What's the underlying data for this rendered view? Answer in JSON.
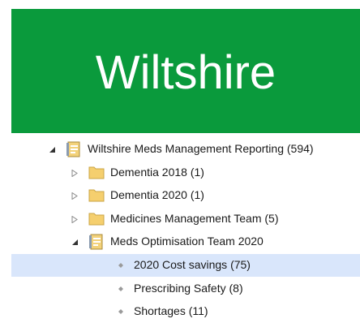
{
  "banner": {
    "title": "Wiltshire"
  },
  "tree": {
    "root": {
      "label": "Wiltshire Meds Management Reporting (594)",
      "expanded": true,
      "icon": "report-book-icon"
    },
    "folders": [
      {
        "label": "Dementia 2018 (1)",
        "expanded": false,
        "icon": "folder-icon"
      },
      {
        "label": "Dementia 2020 (1)",
        "expanded": false,
        "icon": "folder-icon"
      },
      {
        "label": "Medicines Management Team (5)",
        "expanded": false,
        "icon": "folder-icon"
      }
    ],
    "team": {
      "label": "Meds Optimisation Team 2020",
      "expanded": true,
      "icon": "report-book-icon"
    },
    "leaves": [
      {
        "label": "2020 Cost savings (75)",
        "selected": true
      },
      {
        "label": "Prescribing Safety (8)",
        "selected": false
      },
      {
        "label": "Shortages (11)",
        "selected": false
      }
    ]
  },
  "colors": {
    "banner": "#0a9a3c",
    "selected_row": "#d9e6fb"
  }
}
